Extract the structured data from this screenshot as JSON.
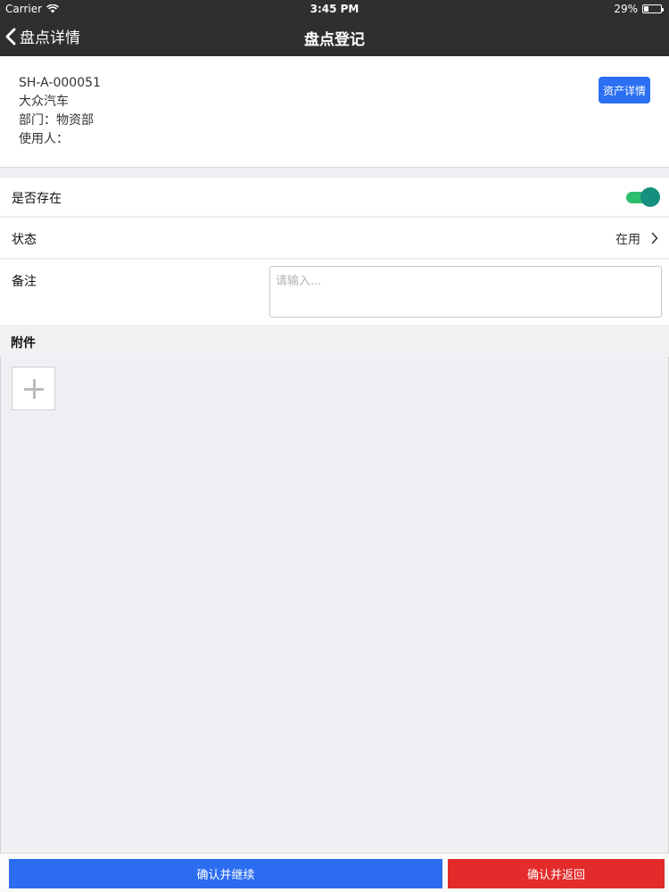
{
  "status_bar": {
    "carrier": "Carrier",
    "time": "3:45 PM",
    "battery": "29%",
    "battery_level": 0.29
  },
  "nav": {
    "back_label": "盘点详情",
    "title": "盘点登记"
  },
  "asset": {
    "code": "SH-A-000051",
    "name": "大众汽车",
    "department": "部门：物资部",
    "user": "使用人：",
    "detail_button": "资产详情"
  },
  "form": {
    "exists_label": "是否存在",
    "exists_value": true,
    "status_label": "状态",
    "status_value": "在用",
    "notes_label": "备注",
    "notes_placeholder": "请输入...",
    "notes_value": ""
  },
  "attachments": {
    "label": "附件"
  },
  "actions": {
    "confirm_continue": "确认并继续",
    "confirm_return": "确认并返回"
  },
  "colors": {
    "nav_background": "#2f2f2f",
    "primary_blue": "#2c6cf0",
    "danger_red": "#e32b2b",
    "toggle_green": "#2dbd6e"
  }
}
